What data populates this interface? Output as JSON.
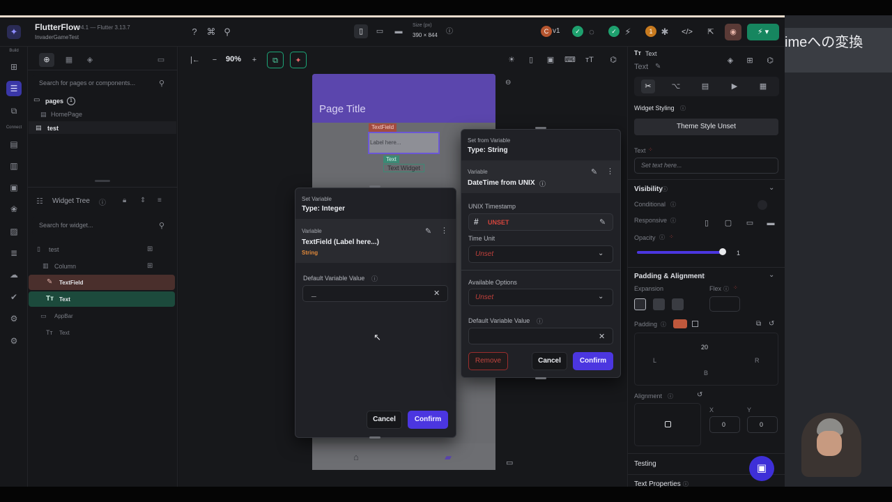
{
  "overlay": {
    "jp_caption": "imeへの変換"
  },
  "header": {
    "app_name": "FlutterFlow",
    "app_version": "v4.1 — Flutter 3.13.7",
    "project_name": "InvaderGameTest",
    "size_label": "Size (px)",
    "size_value": "390 × 844",
    "version_badge": "v1"
  },
  "rail": {
    "build_label": "Build",
    "connect_label": "Connect"
  },
  "left_panel": {
    "search_pages_placeholder": "Search for pages or components...",
    "pages_label": "pages",
    "pages_count": "1",
    "page_home": "HomePage",
    "page_test": "test",
    "widget_tree_label": "Widget Tree",
    "search_widget_placeholder": "Search for widget...",
    "tree": {
      "root": "test",
      "column": "Column",
      "textfield": "TextField",
      "text": "Text",
      "appbar": "AppBar",
      "appbar_text": "Text"
    }
  },
  "canvas": {
    "zoom": "90%",
    "page_title": "Page Title",
    "tf_tag": "TextField",
    "tf_label": "Label here...",
    "text_tag": "Text",
    "text_widget": "Text Widget"
  },
  "dialog_left": {
    "small_title": "Set Variable",
    "type": "Type: Integer",
    "variable_label": "Variable",
    "variable_value": "TextField (Label here...)",
    "variable_type": "String",
    "default_label": "Default Variable Value",
    "default_value": "_",
    "cancel": "Cancel",
    "confirm": "Confirm"
  },
  "dialog_right": {
    "small_title": "Set from Variable",
    "type": "Type: String",
    "variable_label": "Variable",
    "variable_value": "DateTime from UNIX",
    "unix_label": "UNIX Timestamp",
    "unix_value": "UNSET",
    "time_unit_label": "Time Unit",
    "time_unit_value": "Unset",
    "available_label": "Available Options",
    "available_value": "Unset",
    "default_label": "Default Variable Value",
    "remove": "Remove",
    "cancel": "Cancel",
    "confirm": "Confirm"
  },
  "right_panel": {
    "widget_type": "Text",
    "widget_name": "Text",
    "widget_styling": "Widget Styling",
    "theme_style": "Theme Style Unset",
    "text_label": "Text",
    "text_placeholder": "Set text here...",
    "visibility": "Visibility",
    "conditional": "Conditional",
    "responsive": "Responsive",
    "opacity": "Opacity",
    "opacity_value": "1",
    "padding_alignment": "Padding & Alignment",
    "expansion": "Expansion",
    "flex": "Flex",
    "padding": "Padding",
    "pad_top": "20",
    "pad_l": "L",
    "pad_r": "R",
    "pad_b": "B",
    "alignment": "Alignment",
    "x_label": "X",
    "y_label": "Y",
    "x_value": "0",
    "y_value": "0",
    "testing": "Testing",
    "text_properties": "Text Properties"
  },
  "colors": {
    "accent": "#4b36e0",
    "appbar": "#5b46ad",
    "unset_red": "#c0403b",
    "string_orange": "#e0883a",
    "green": "#1ca678"
  }
}
